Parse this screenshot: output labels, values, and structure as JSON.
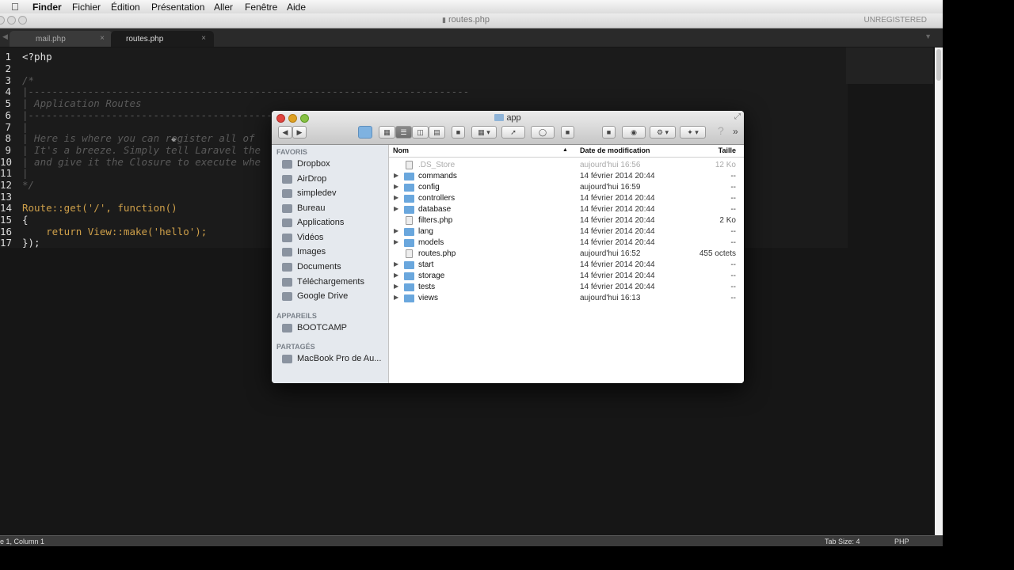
{
  "menubar": {
    "items": [
      "Finder",
      "Fichier",
      "Édition",
      "Présentation",
      "Aller",
      "Fenêtre",
      "Aide"
    ]
  },
  "editor": {
    "window_title": "routes.php",
    "unregistered": "UNREGISTERED",
    "tabs": [
      {
        "label": "mail.php",
        "close": "×"
      },
      {
        "label": "routes.php",
        "close": "×"
      }
    ],
    "lines": [
      {
        "n": "1",
        "text": "<?php"
      },
      {
        "n": "2",
        "text": ""
      },
      {
        "n": "3",
        "text": "/*"
      },
      {
        "n": "4",
        "text": "|--------------------------------------------------------------------------"
      },
      {
        "n": "5",
        "text": "| Application Routes"
      },
      {
        "n": "6",
        "text": "|--------------------------------------------------------------------------"
      },
      {
        "n": "7",
        "text": "|"
      },
      {
        "n": "8",
        "text": "| Here is where you can register all of"
      },
      {
        "n": "9",
        "text": "| It's a breeze. Simply tell Laravel the"
      },
      {
        "n": "10",
        "text": "| and give it the Closure to execute whe"
      },
      {
        "n": "11",
        "text": "|"
      },
      {
        "n": "12",
        "text": "*/"
      },
      {
        "n": "13",
        "text": ""
      },
      {
        "n": "14",
        "text": "Route::get('/', function()"
      },
      {
        "n": "15",
        "text": "{"
      },
      {
        "n": "16",
        "text": "    return View::make('hello');"
      },
      {
        "n": "17",
        "text": "});"
      }
    ],
    "status": {
      "position": "e 1, Column 1",
      "tab_size": "Tab Size: 4",
      "syntax": "PHP"
    }
  },
  "finder": {
    "title": "app",
    "sidebar": {
      "favorites_label": "FAVORIS",
      "favorites": [
        {
          "label": "Dropbox",
          "icon": "dropbox-icon"
        },
        {
          "label": "AirDrop",
          "icon": "airdrop-icon"
        },
        {
          "label": "simpledev",
          "icon": "home-icon"
        },
        {
          "label": "Bureau",
          "icon": "desktop-icon"
        },
        {
          "label": "Applications",
          "icon": "applications-icon"
        },
        {
          "label": "Vidéos",
          "icon": "movies-icon"
        },
        {
          "label": "Images",
          "icon": "pictures-icon"
        },
        {
          "label": "Documents",
          "icon": "documents-icon"
        },
        {
          "label": "Téléchargements",
          "icon": "downloads-icon"
        },
        {
          "label": "Google Drive",
          "icon": "folder-icon"
        }
      ],
      "devices_label": "APPAREILS",
      "devices": [
        {
          "label": "BOOTCAMP",
          "icon": "disk-icon"
        }
      ],
      "shared_label": "PARTAGÉS",
      "shared": [
        {
          "label": "MacBook Pro de Au...",
          "icon": "computer-icon"
        }
      ]
    },
    "columns": {
      "name": "Nom",
      "date": "Date de modification",
      "size": "Taille"
    },
    "files": [
      {
        "name": ".DS_Store",
        "date": "aujourd'hui 16:56",
        "size": "12 Ko",
        "folder": false,
        "faded": true
      },
      {
        "name": "commands",
        "date": "14 février 2014 20:44",
        "size": "--",
        "folder": true
      },
      {
        "name": "config",
        "date": "aujourd'hui 16:59",
        "size": "--",
        "folder": true
      },
      {
        "name": "controllers",
        "date": "14 février 2014 20:44",
        "size": "--",
        "folder": true
      },
      {
        "name": "database",
        "date": "14 février 2014 20:44",
        "size": "--",
        "folder": true
      },
      {
        "name": "filters.php",
        "date": "14 février 2014 20:44",
        "size": "2 Ko",
        "folder": false
      },
      {
        "name": "lang",
        "date": "14 février 2014 20:44",
        "size": "--",
        "folder": true
      },
      {
        "name": "models",
        "date": "14 février 2014 20:44",
        "size": "--",
        "folder": true
      },
      {
        "name": "routes.php",
        "date": "aujourd'hui 16:52",
        "size": "455 octets",
        "folder": false
      },
      {
        "name": "start",
        "date": "14 février 2014 20:44",
        "size": "--",
        "folder": true
      },
      {
        "name": "storage",
        "date": "14 février 2014 20:44",
        "size": "--",
        "folder": true
      },
      {
        "name": "tests",
        "date": "14 février 2014 20:44",
        "size": "--",
        "folder": true
      },
      {
        "name": "views",
        "date": "aujourd'hui 16:13",
        "size": "--",
        "folder": true
      }
    ]
  }
}
